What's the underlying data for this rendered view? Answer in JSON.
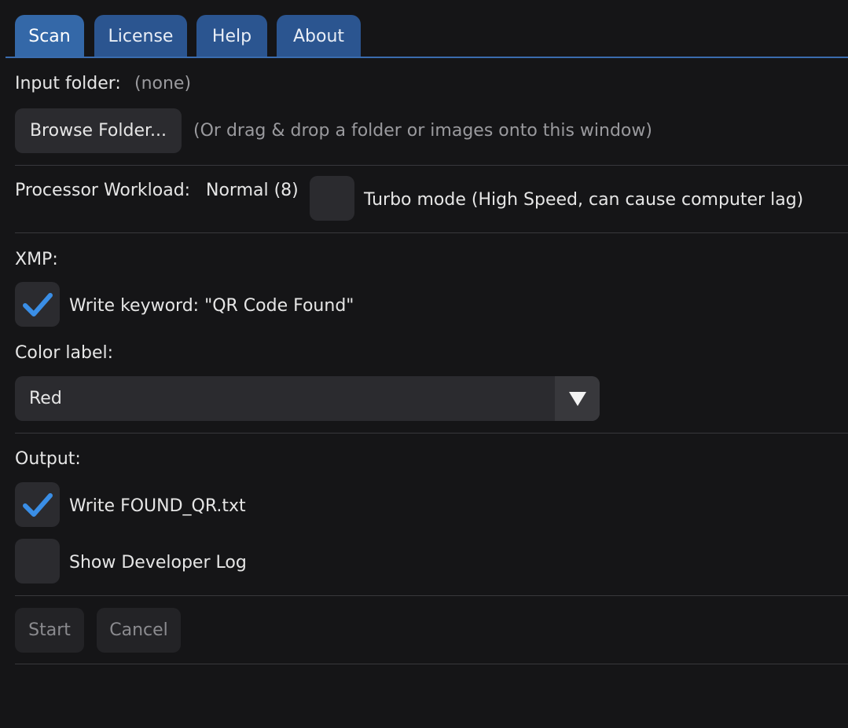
{
  "tabs": [
    {
      "label": "Scan",
      "active": true
    },
    {
      "label": "License",
      "active": false
    },
    {
      "label": "Help",
      "active": false
    },
    {
      "label": "About",
      "active": false
    }
  ],
  "input": {
    "label": "Input folder:",
    "value": "(none)",
    "browse_button": "Browse Folder...",
    "hint": "(Or drag & drop a folder or images onto this window)"
  },
  "workload": {
    "label": "Processor Workload:",
    "value": "Normal (8)",
    "turbo_label": "Turbo mode (High Speed, can cause computer lag)",
    "turbo_checked": false
  },
  "xmp": {
    "heading": "XMP:",
    "write_keyword_label": "Write keyword: \"QR Code Found\"",
    "write_keyword_checked": true,
    "color_label": "Color label:",
    "color_selected": "Red"
  },
  "output": {
    "heading": "Output:",
    "write_found_label": "Write FOUND_QR.txt",
    "write_found_checked": true,
    "dev_log_label": "Show Developer Log",
    "dev_log_checked": false
  },
  "actions": {
    "start": "Start",
    "cancel": "Cancel"
  },
  "colors": {
    "accent": "#3a8ee6",
    "tab_active": "#3468a8",
    "tab_inactive": "#2b5590",
    "background": "#151517"
  },
  "icons": {
    "check": "checkmark-icon",
    "dropdown": "triangle-down-icon"
  }
}
